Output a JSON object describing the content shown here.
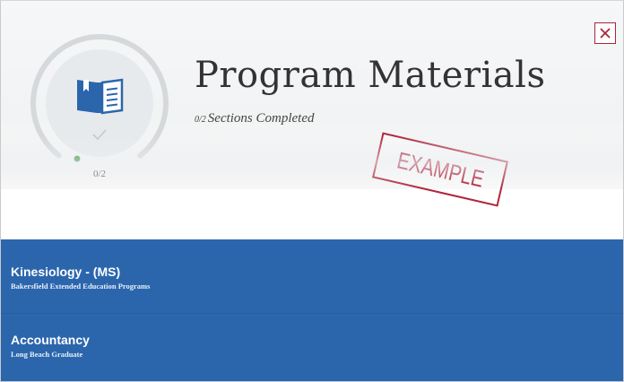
{
  "header": {
    "title": "Program Materials",
    "progress_fraction": "0/2",
    "progress_text": "Sections Completed",
    "example_stamp": "EXAMPLE",
    "close_icon": "close-x-icon"
  },
  "progress_ring": {
    "label": "0/2",
    "completed": 0,
    "total": 2,
    "icon": "book-icon",
    "status_icon": "checkmark-icon"
  },
  "programs": [
    {
      "name": "Kinesiology - (MS)",
      "campus": "Bakersfield Extended Education Programs"
    },
    {
      "name": "Accountancy",
      "campus": "Long Beach Graduate"
    }
  ],
  "colors": {
    "list_background": "#2b66ad",
    "accent_red": "#b0263c",
    "progress_dot": "#2e8b2e",
    "ring_track": "#d6d9dc",
    "book_blue": "#2b66ad"
  }
}
